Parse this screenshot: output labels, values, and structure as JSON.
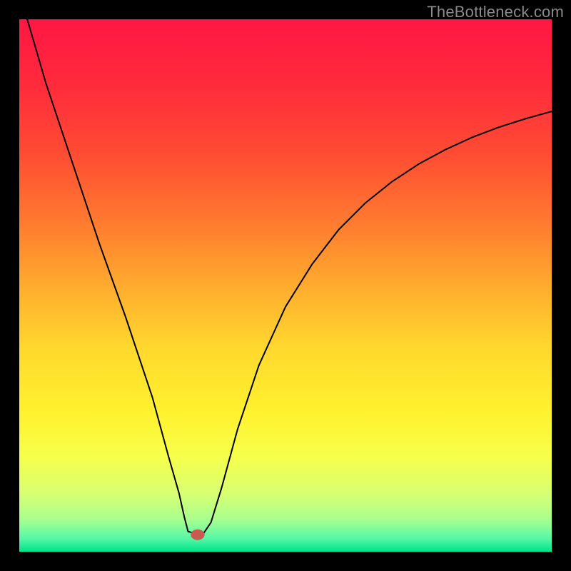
{
  "watermark": "TheBottleneck.com",
  "chart_data": {
    "type": "line",
    "title": "",
    "xlabel": "",
    "ylabel": "",
    "xlim": [
      0,
      100
    ],
    "ylim": [
      0,
      100
    ],
    "grid": false,
    "legend": false,
    "background_gradient": {
      "stops": [
        {
          "offset": 0.0,
          "color": "#ff1744"
        },
        {
          "offset": 0.12,
          "color": "#ff2a3c"
        },
        {
          "offset": 0.25,
          "color": "#ff4b33"
        },
        {
          "offset": 0.38,
          "color": "#ff7a2f"
        },
        {
          "offset": 0.5,
          "color": "#ffab2e"
        },
        {
          "offset": 0.62,
          "color": "#ffd92e"
        },
        {
          "offset": 0.74,
          "color": "#fff22e"
        },
        {
          "offset": 0.82,
          "color": "#f6ff4a"
        },
        {
          "offset": 0.89,
          "color": "#d9ff72"
        },
        {
          "offset": 0.94,
          "color": "#a7ff8e"
        },
        {
          "offset": 0.975,
          "color": "#57f7a7"
        },
        {
          "offset": 1.0,
          "color": "#00e38a"
        }
      ]
    },
    "series": [
      {
        "name": "bottleneck-curve",
        "color": "#000000",
        "x": [
          1.5,
          5,
          10,
          15,
          20,
          25,
          28,
          30,
          31,
          31.7,
          33.5,
          34.5,
          36,
          38,
          41,
          45,
          50,
          55,
          60,
          65,
          70,
          75,
          80,
          85,
          90,
          95,
          100
        ],
        "y": [
          100,
          88,
          73,
          58,
          44,
          29,
          18,
          11,
          6.5,
          3.8,
          3.3,
          3.3,
          5.5,
          12,
          23,
          35,
          46,
          54,
          60.5,
          65.5,
          69.5,
          72.8,
          75.5,
          77.8,
          79.7,
          81.3,
          82.7
        ]
      }
    ],
    "marker": {
      "x": 33.5,
      "y": 3.2,
      "rx": 1.3,
      "ry": 1.0,
      "color": "#c95a4f"
    }
  }
}
